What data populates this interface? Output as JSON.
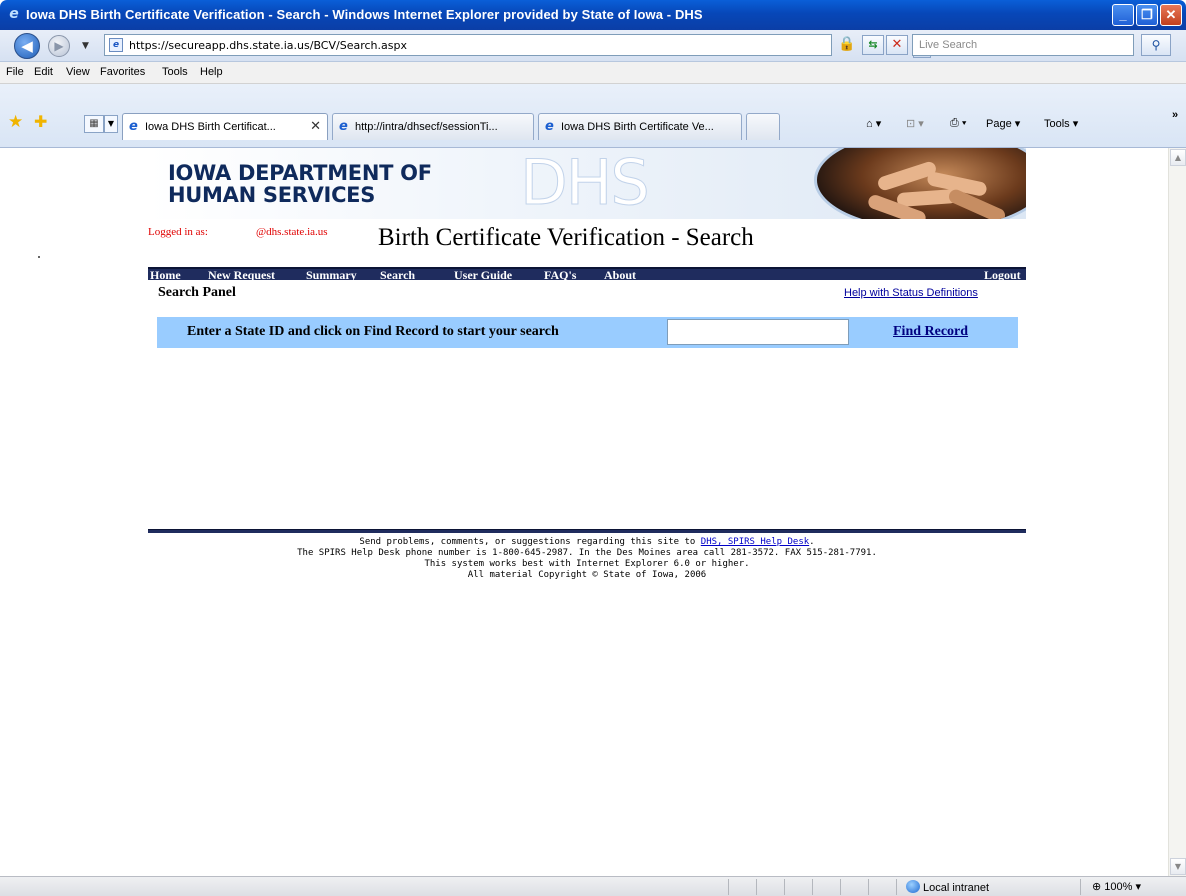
{
  "window": {
    "title": "Iowa DHS Birth Certificate Verification - Search - Windows Internet Explorer provided by State of Iowa - DHS",
    "minimize": "_",
    "maximize": "❐",
    "close": "✕"
  },
  "address": {
    "url": "https://secureapp.dhs.state.ia.us/BCV/Search.aspx",
    "search_placeholder": "Live Search"
  },
  "menu": [
    "File",
    "Edit",
    "View",
    "Favorites",
    "Tools",
    "Help"
  ],
  "tabs": [
    {
      "label": "Iowa DHS Birth Certificat...",
      "active": true,
      "close": "✕"
    },
    {
      "label": "http://intra/dhsecf/sessionTi...",
      "active": false
    },
    {
      "label": "Iowa DHS Birth Certificate Ve...",
      "active": false
    }
  ],
  "toolbar_right": {
    "page": "Page ▾",
    "tools": "Tools ▾",
    "more": "»"
  },
  "banner": {
    "org_line1": "IOWA DEPARTMENT OF",
    "org_line2": "HUMAN SERVICES",
    "watermark": "DHS"
  },
  "user": {
    "logged_label": "Logged in as:",
    "logged_value": "@dhs.state.ia.us"
  },
  "page_title": "Birth Certificate Verification - Search",
  "nav": [
    "Home",
    "New Request",
    "Summary",
    "Search",
    "User Guide",
    "FAQ's",
    "About"
  ],
  "logout": "Logout",
  "panel": {
    "title": "Search Panel",
    "help_link": "Help with Status Definitions",
    "prompt": "Enter a State ID and click on Find Record to start your search",
    "state_id_value": "",
    "find_label": "Find Record"
  },
  "footer": {
    "line1_prefix": "Send problems, comments, or suggestions regarding this site to ",
    "line1_link": "DHS, SPIRS Help Desk",
    "line1_suffix": ".",
    "line2": "The SPIRS Help Desk phone number is 1-800-645-2987.  In the Des Moines area call 281-3572.  FAX 515-281-7791.",
    "line3": "This system works best with Internet Explorer 6.0 or higher.",
    "line4": "All material Copyright © State of Iowa, 2006"
  },
  "status": {
    "zone": "Local intranet",
    "zoom": "100%",
    "zoom_percent": 100
  },
  "icons": {
    "back": "back-arrow-icon",
    "forward": "forward-arrow-icon",
    "lock": "lock-icon",
    "refresh": "refresh-icon",
    "stop": "stop-icon",
    "search": "search-icon",
    "favorites": "favorites-star-icon",
    "add_favorites": "add-favorites-icon",
    "home": "home-icon",
    "feeds": "feeds-icon",
    "print": "print-icon",
    "globe": "globe-icon",
    "zoom": "zoom-icon"
  }
}
